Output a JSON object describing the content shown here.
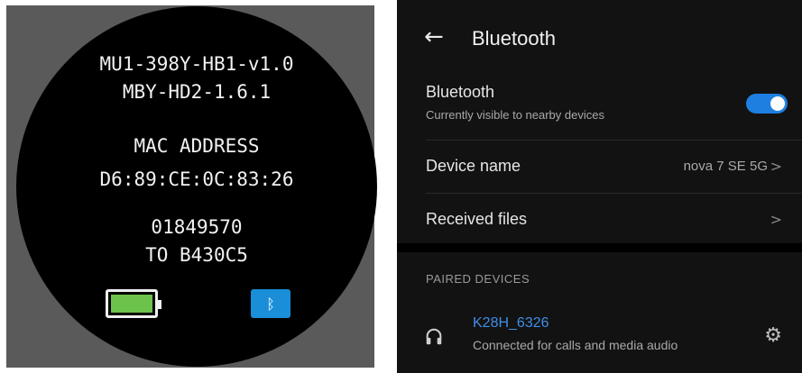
{
  "watch": {
    "lines": [
      "MU1-398Y-HB1-v1.0",
      "MBY-HD2-1.6.1",
      "MAC ADDRESS",
      "D6:89:CE:0C:83:26",
      "01849570",
      "TO B430C5"
    ],
    "battery_level": 1.0,
    "bluetooth_glyph": "ᛒ",
    "colors": {
      "battery": "#6cc24a",
      "bluetooth_badge": "#1a8ed8"
    }
  },
  "phone": {
    "header": {
      "back_glyph": "←",
      "title": "Bluetooth"
    },
    "bluetooth_row": {
      "label": "Bluetooth",
      "sublabel": "Currently visible to nearby devices",
      "toggle_on": true
    },
    "device_name_row": {
      "label": "Device name",
      "value": "nova 7 SE 5G",
      "chevron": ">"
    },
    "received_files_row": {
      "label": "Received files",
      "chevron": ">"
    },
    "paired_section": {
      "header": "PAIRED DEVICES"
    },
    "paired_devices": [
      {
        "icon": "headset-icon",
        "name": "K28H_6326",
        "status": "Connected for calls and media audio",
        "settings_glyph": "⚙"
      }
    ],
    "colors": {
      "accent": "#1e7fe0",
      "link": "#3f8fe8",
      "background": "#121212"
    }
  }
}
